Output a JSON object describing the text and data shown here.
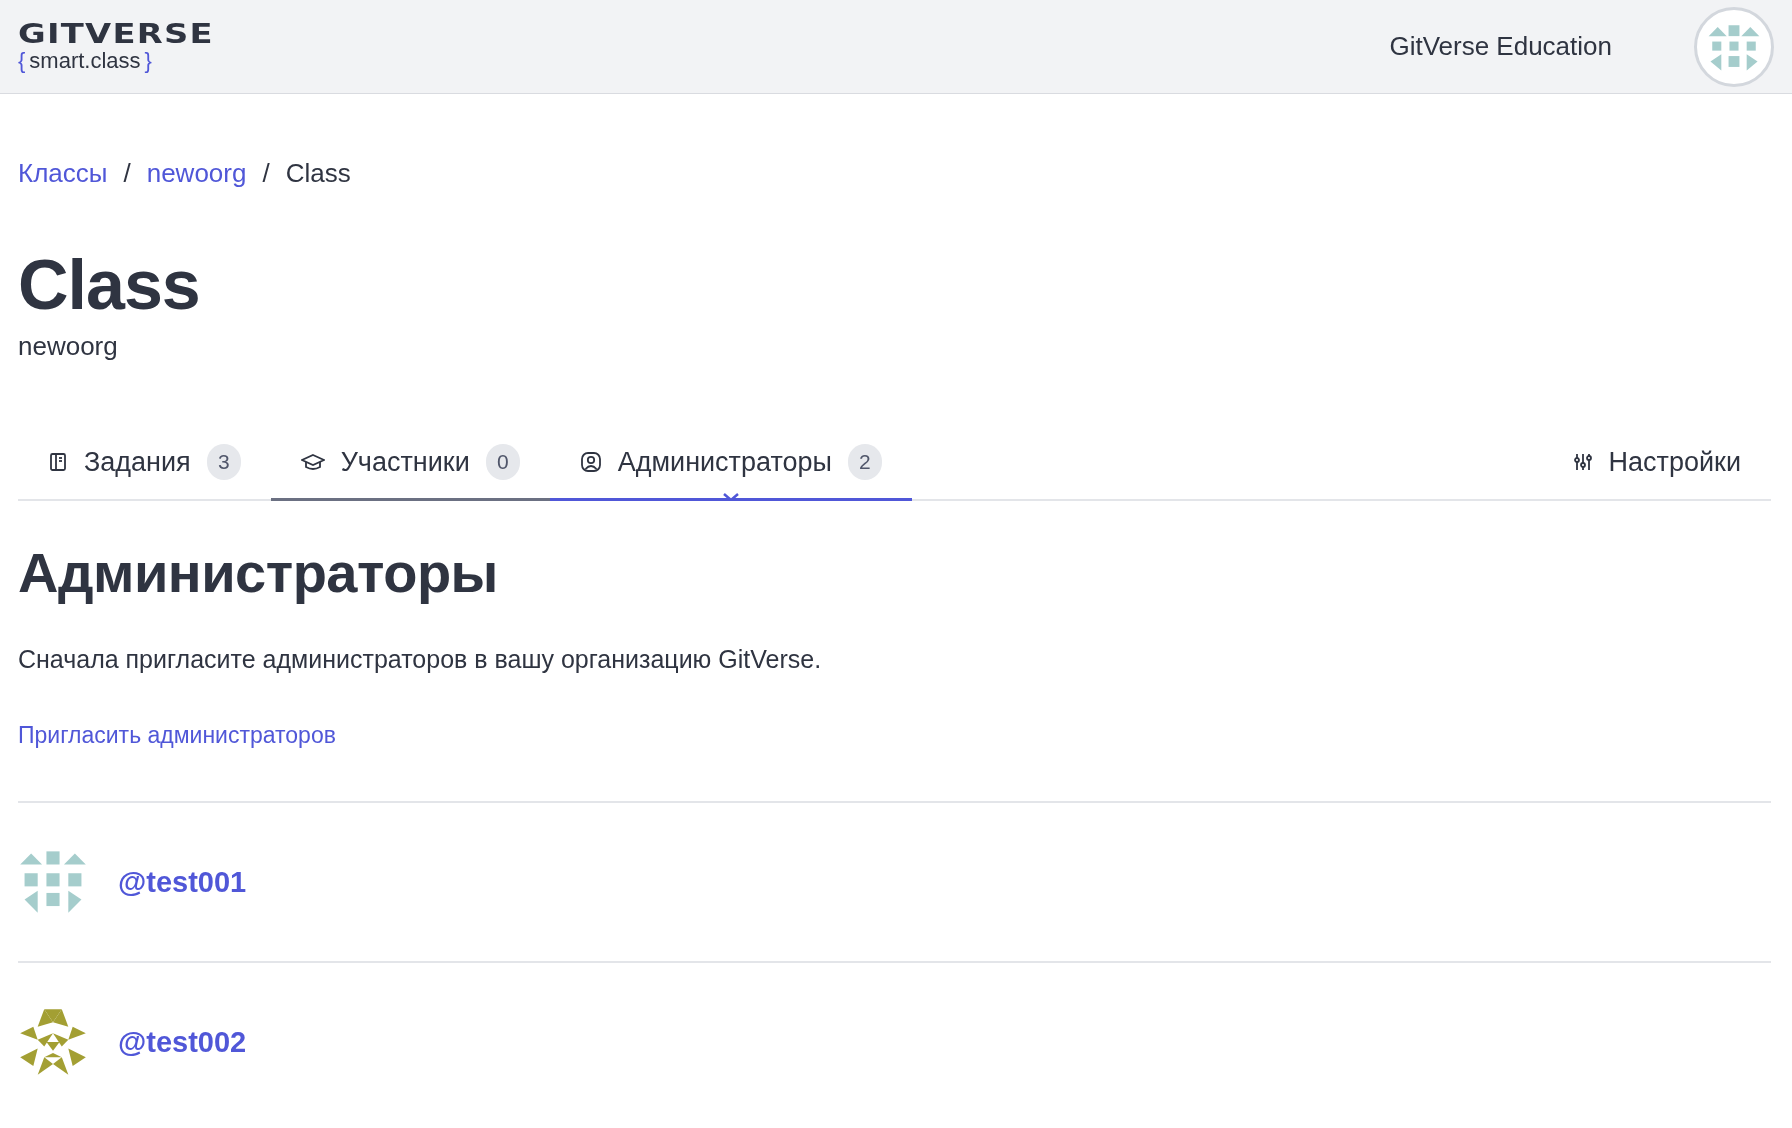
{
  "header": {
    "logo_title": "GITVERSE",
    "logo_open": "{",
    "logo_text": "smart.class",
    "logo_close": "}",
    "org_name": "GitVerse Education",
    "avatar": {
      "kind": "blocks",
      "color": "#a5cdcc"
    }
  },
  "breadcrumbs": [
    {
      "label": "Классы",
      "link": true
    },
    {
      "label": "newoorg",
      "link": true
    },
    {
      "label": "Class",
      "link": false
    }
  ],
  "breadcrumb_separator": "/",
  "page": {
    "title": "Class",
    "subtitle": "newoorg"
  },
  "tabs": [
    {
      "label": "Задания",
      "count": "3",
      "kind": "book",
      "selected": false,
      "hovered": false
    },
    {
      "label": "Участники",
      "count": "0",
      "kind": "cap",
      "selected": false,
      "hovered": true
    },
    {
      "label": "Администраторы",
      "count": "2",
      "kind": "user",
      "selected": true,
      "hovered": false
    }
  ],
  "settings_tab": {
    "label": "Настройки"
  },
  "section": {
    "title": "Администраторы",
    "description": "Сначала пригласите администраторов в вашу организацию GitVerse.",
    "invite_link": "Пригласить администраторов"
  },
  "admins": [
    {
      "username": "@test001",
      "avatar": {
        "kind": "blocks",
        "color": "#a5cdcc"
      }
    },
    {
      "username": "@test002",
      "avatar": {
        "kind": "star",
        "color": "#a39f33"
      }
    }
  ]
}
